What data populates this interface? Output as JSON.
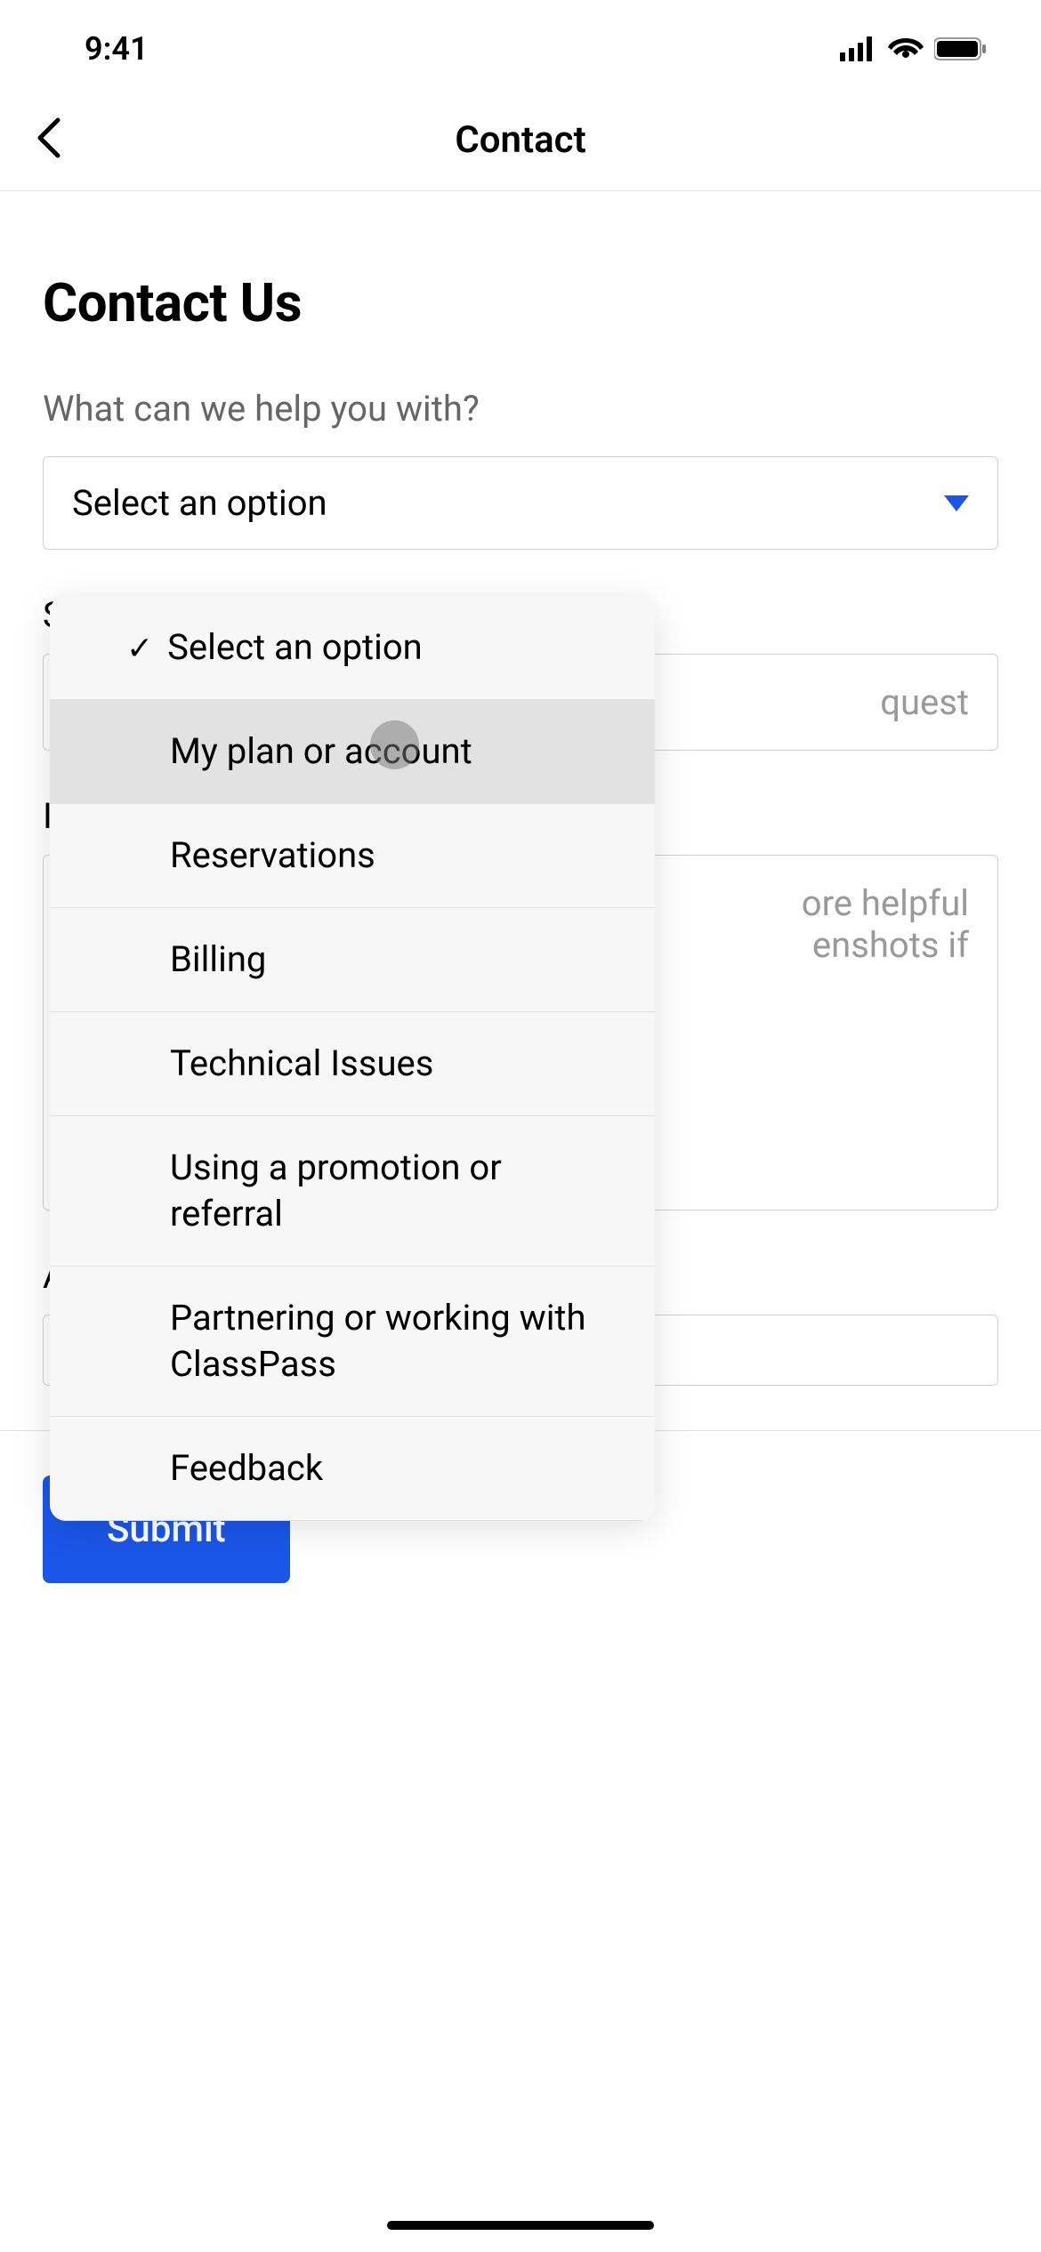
{
  "status": {
    "time": "9:41"
  },
  "nav": {
    "title": "Contact"
  },
  "page": {
    "heading": "Contact Us",
    "topic_label": "What can we help you with?",
    "select_placeholder": "Select an option",
    "subject_label": "Subject",
    "subject_placeholder_visible": "quest",
    "message_label": "I",
    "message_placeholder_line1": "ore helpful",
    "message_placeholder_line2": "enshots if",
    "attach_label": "A",
    "submit_label": "Submit"
  },
  "dropdown": {
    "items": [
      {
        "label": "Select an option",
        "checked": true
      },
      {
        "label": "My plan or account",
        "highlighted": true
      },
      {
        "label": "Reservations"
      },
      {
        "label": "Billing"
      },
      {
        "label": "Technical Issues"
      },
      {
        "label": "Using a promotion or referral"
      },
      {
        "label": "Partnering or working with ClassPass"
      },
      {
        "label": "Feedback"
      }
    ]
  },
  "colors": {
    "accent": "#1a56e8"
  }
}
